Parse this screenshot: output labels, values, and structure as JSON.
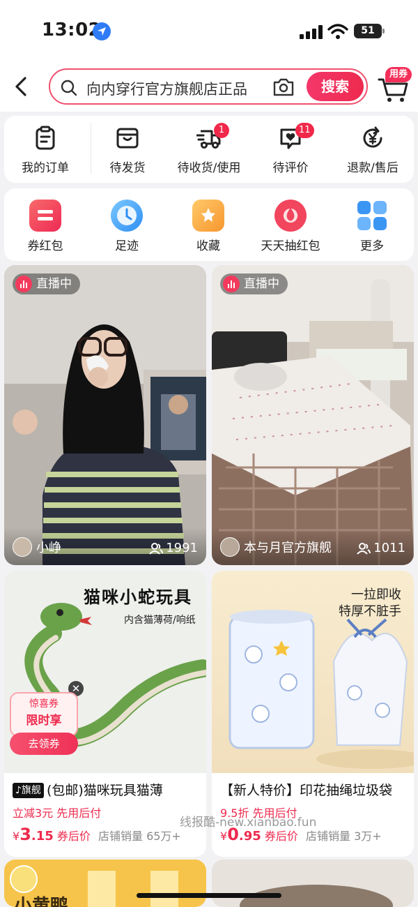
{
  "status": {
    "time": "13:02",
    "battery": "51"
  },
  "search": {
    "query": "向内穿行官方旗舰店正品",
    "button": "搜索",
    "cart_badge": "用券"
  },
  "orders": [
    {
      "label": "我的订单",
      "icon": "clipboard-icon",
      "badge": ""
    },
    {
      "label": "待发货",
      "icon": "box-icon",
      "badge": ""
    },
    {
      "label": "待收货/使用",
      "icon": "truck-icon",
      "badge": "1"
    },
    {
      "label": "待评价",
      "icon": "heart-message-icon",
      "badge": "11"
    },
    {
      "label": "退款/售后",
      "icon": "yuan-return-icon",
      "badge": ""
    }
  ],
  "tools": [
    {
      "label": "券红包",
      "icon": "coupon-icon",
      "color": "#f4395c"
    },
    {
      "label": "足迹",
      "icon": "clock-icon",
      "color": "#3a9df5"
    },
    {
      "label": "收藏",
      "icon": "star-folder-icon",
      "color": "#f9a23a"
    },
    {
      "label": "天天抽红包",
      "icon": "lucky-draw-icon",
      "color": "#f2455e"
    },
    {
      "label": "更多",
      "icon": "grid-icon",
      "color": "#3b95f3"
    }
  ],
  "live": [
    {
      "badge": "直播中",
      "streamer": "小峥",
      "viewers": "1991"
    },
    {
      "badge": "直播中",
      "streamer": "本与月官方旗舰",
      "viewers": "1011"
    }
  ],
  "products": [
    {
      "image_headline": "猫咪小蛇玩具",
      "image_sub": "内含猫薄荷/响纸",
      "coupon_top": "惊喜券",
      "coupon_mid": "限时享",
      "coupon_btn": "去领券",
      "flag": "♪旗舰",
      "title": "(包邮)猫咪玩具猫薄",
      "promo": "立减3元  先用后付",
      "currency": "¥",
      "price": "3",
      "price_dec": ".15",
      "price_suffix": "券后价",
      "sales": "店铺销量 65万+"
    },
    {
      "image_headline": "一拉即收",
      "image_sub": "特厚不脏手",
      "title": "【新人特价】印花抽绳垃圾袋",
      "promo": "9.5折  先用后付",
      "currency": "¥",
      "price": "0",
      "price_dec": ".95",
      "price_suffix": "券后价",
      "sales": "店铺销量 3万+"
    }
  ],
  "next_row": {
    "left_label": "小黄鸭"
  },
  "watermark": "线报酷-new.xianbao.fun"
}
